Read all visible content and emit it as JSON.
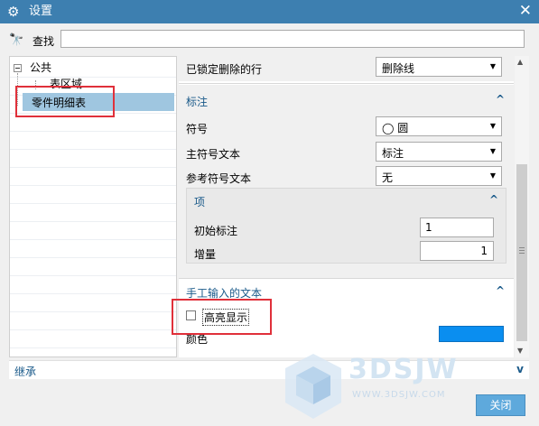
{
  "window": {
    "title": "设置",
    "close_glyph": "✕",
    "gear_icon": "gear-icon"
  },
  "search": {
    "label": "查找",
    "value": "",
    "placeholder": ""
  },
  "tree": {
    "root": "公共",
    "child": "表区域",
    "selected": "零件明细表"
  },
  "panel": {
    "locked_delete_label": "已锁定删除的行",
    "locked_delete_value": "删除线",
    "annotation_group": "标注",
    "symbol_label": "符号",
    "symbol_value": "圆",
    "main_symbol_text_label": "主符号文本",
    "main_symbol_text_value": "标注",
    "ref_symbol_text_label": "参考符号文本",
    "ref_symbol_text_value": "无",
    "item_group": "项",
    "initial_label": "初始标注",
    "initial_value": "1",
    "increment_label": "增量",
    "increment_value": "1",
    "manual_text_group": "手工输入的文本",
    "highlight_label": "高亮显示",
    "highlight_checked": false,
    "color_label": "颜色",
    "color_value": "#0a8ef0"
  },
  "inherit_label": "继承",
  "close_button": "关闭",
  "watermark": {
    "big": "3DSJW",
    "small": "WWW.3DSJW.COM"
  },
  "colors": {
    "titlebar": "#3d7fb0",
    "accent": "#1a5a8a",
    "selection": "#9fc6e0",
    "highlight_box": "#e0303a"
  }
}
